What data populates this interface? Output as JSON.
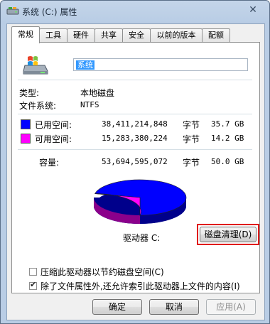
{
  "window": {
    "title": "系统 (C:) 属性",
    "close_glyph": "✕"
  },
  "tabs": [
    {
      "label": "常规"
    },
    {
      "label": "工具"
    },
    {
      "label": "硬件"
    },
    {
      "label": "共享"
    },
    {
      "label": "安全"
    },
    {
      "label": "以前的版本"
    },
    {
      "label": "配额"
    }
  ],
  "general": {
    "volume_name": "系统",
    "type_label": "类型:",
    "type_value": "本地磁盘",
    "fs_label": "文件系统:",
    "fs_value": "NTFS",
    "used": {
      "label": "已用空间:",
      "bytes": "38,411,214,848",
      "unit": "字节",
      "size": "35.7 GB",
      "color": "#0000ff"
    },
    "free": {
      "label": "可用空间:",
      "bytes": "15,283,380,224",
      "unit": "字节",
      "size": "14.2 GB",
      "color": "#ff00ff"
    },
    "capacity": {
      "label": "容量:",
      "bytes": "53,694,595,072",
      "unit": "字节",
      "size": "50.0 GB"
    },
    "used_fraction": 0.7154,
    "drive_label": "驱动器 C:",
    "cleanup_button": "磁盘清理(D)"
  },
  "options": {
    "compress": {
      "label": "压缩此驱动器以节约磁盘空间(C)",
      "checked": false
    },
    "index": {
      "label": "除了文件属性外,还允许索引此驱动器上文件的内容(I)",
      "checked": true,
      "mark": "✔"
    }
  },
  "buttons": {
    "ok": "确定",
    "cancel": "取消",
    "apply": "应用(A)"
  }
}
